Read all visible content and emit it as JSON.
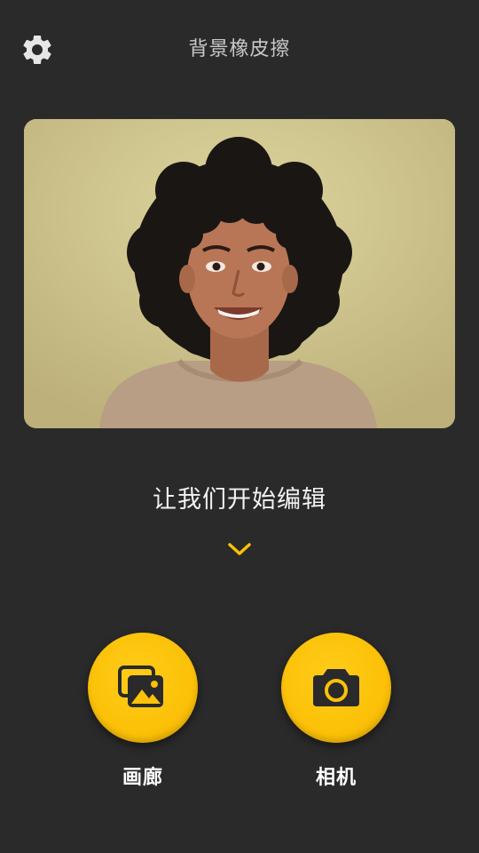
{
  "header": {
    "settings_icon": "gear-icon",
    "title": "背景橡皮擦"
  },
  "preview": {
    "subject": "smiling woman with curly black hair on yellow background"
  },
  "prompt": {
    "text": "让我们开始编辑",
    "chevron_icon": "chevron-down-icon"
  },
  "actions": [
    {
      "label": "画廊",
      "icon": "gallery-icon"
    },
    {
      "label": "相机",
      "icon": "camera-icon"
    }
  ],
  "colors": {
    "background": "#2a2a2a",
    "accent": "#fcc108",
    "title_text": "#c9c9c9",
    "prompt_text": "#f2f2f2"
  }
}
